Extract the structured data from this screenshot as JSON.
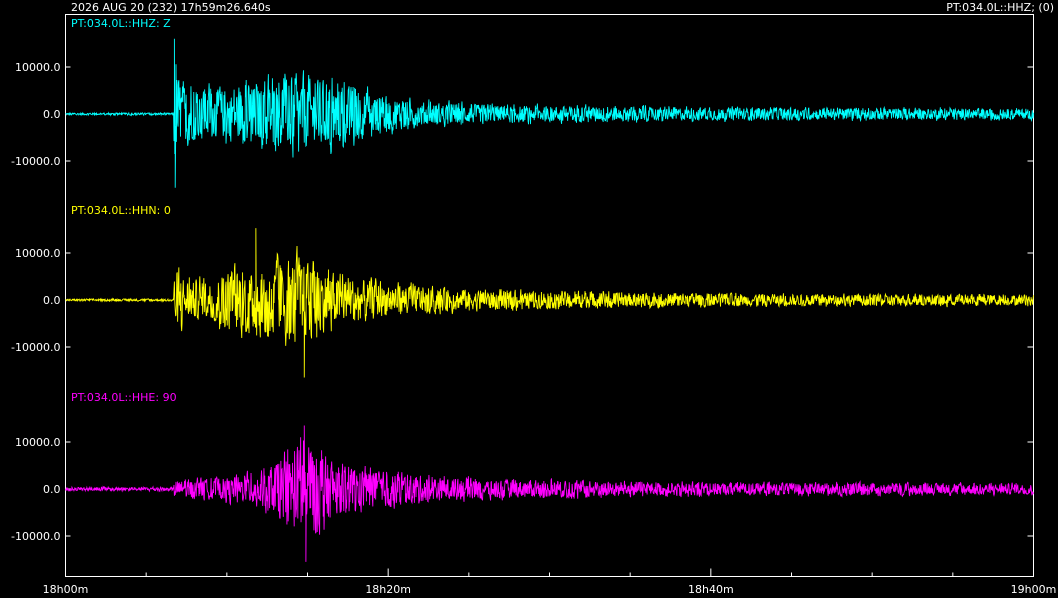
{
  "header": {
    "left": "2026 AUG 20 (232)  17h59m26.640s",
    "right": "PT:034.0L::HHZ; (0)"
  },
  "chart_data": {
    "type": "line",
    "x_axis": {
      "ticks": [
        {
          "minute": 0,
          "label": "18h00m"
        },
        {
          "minute": 20,
          "label": "18h20m"
        },
        {
          "minute": 40,
          "label": "18h40m"
        },
        {
          "minute": 60,
          "label": "19h00m"
        }
      ],
      "range_minutes": [
        0,
        60
      ]
    },
    "series": [
      {
        "name": "PT:034.0L::HHZ: Z",
        "color": "#00ffff",
        "y_ticks": [
          "10000.0",
          "0.0",
          "-10000.0"
        ],
        "ylim": [
          -16000,
          16000
        ],
        "noise_amp": 300,
        "envelope": [
          [
            0,
            300
          ],
          [
            6.7,
            300
          ],
          [
            6.75,
            16000
          ],
          [
            7.2,
            9000
          ],
          [
            8,
            7000
          ],
          [
            9.5,
            7000
          ],
          [
            10.5,
            8000
          ],
          [
            12.5,
            9000
          ],
          [
            14.5,
            10500
          ],
          [
            16,
            9500
          ],
          [
            18,
            7500
          ],
          [
            20,
            5000
          ],
          [
            22,
            3500
          ],
          [
            26,
            2600
          ],
          [
            35,
            2000
          ],
          [
            45,
            1700
          ],
          [
            60,
            1500
          ]
        ],
        "max_pos": 16000,
        "max_neg": -15700
      },
      {
        "name": "PT:034.0L::HHN: 0",
        "color": "#ffff00",
        "y_ticks": [
          "10000.0",
          "0.0",
          "-10000.0"
        ],
        "ylim": [
          -16000,
          16000
        ],
        "noise_amp": 300,
        "envelope": [
          [
            0,
            300
          ],
          [
            6.7,
            300
          ],
          [
            6.75,
            9500
          ],
          [
            7.5,
            6000
          ],
          [
            9,
            5500
          ],
          [
            10.5,
            9500
          ],
          [
            12,
            9000
          ],
          [
            13.5,
            11000
          ],
          [
            14.5,
            12000
          ],
          [
            15.5,
            10000
          ],
          [
            17,
            7000
          ],
          [
            20,
            4500
          ],
          [
            25,
            2800
          ],
          [
            35,
            2000
          ],
          [
            45,
            1700
          ],
          [
            60,
            1500
          ]
        ],
        "max_pos": 15300,
        "max_neg": -16500
      },
      {
        "name": "PT:034.0L::HHE: 90",
        "color": "#ff00ff",
        "y_ticks": [
          "10000.0",
          "0.0",
          "-10000.0"
        ],
        "ylim": [
          -16000,
          16000
        ],
        "noise_amp": 500,
        "envelope": [
          [
            0,
            500
          ],
          [
            6.7,
            500
          ],
          [
            6.75,
            2600
          ],
          [
            8.5,
            2800
          ],
          [
            10.5,
            3400
          ],
          [
            12,
            5000
          ],
          [
            13.5,
            9000
          ],
          [
            14.8,
            14000
          ],
          [
            15.8,
            11000
          ],
          [
            17,
            7000
          ],
          [
            20,
            4800
          ],
          [
            24,
            3000
          ],
          [
            30,
            2400
          ],
          [
            40,
            1800
          ],
          [
            60,
            1500
          ]
        ],
        "max_pos": 13500,
        "max_neg": -15500
      }
    ]
  }
}
